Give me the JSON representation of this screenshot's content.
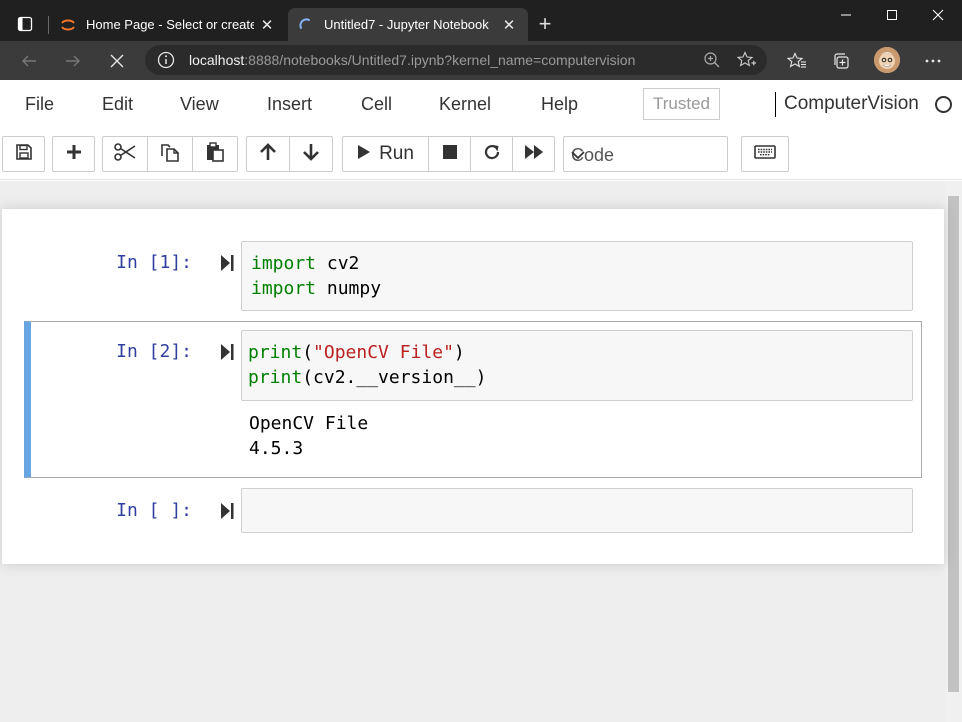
{
  "browser": {
    "tabs": [
      {
        "title": "Home Page - Select or create a n",
        "icon": "jupyter-logo-icon",
        "active": false
      },
      {
        "title": "Untitled7 - Jupyter Notebook",
        "icon": "loading-spinner-icon",
        "active": true
      }
    ],
    "url_host": "localhost",
    "url_rest": ":8888/notebooks/Untitled7.ipynb?kernel_name=computervision"
  },
  "menu": {
    "items": [
      "File",
      "Edit",
      "View",
      "Insert",
      "Cell",
      "Kernel",
      "Help"
    ],
    "trusted": "Trusted",
    "kernel_name": "ComputerVision"
  },
  "toolbar": {
    "run_label": "Run",
    "cell_type": "Code"
  },
  "cells": [
    {
      "prompt": "In [1]:",
      "code": [
        "import cv2",
        "import numpy"
      ],
      "output": []
    },
    {
      "prompt": "In [2]:",
      "code": [
        "print(\"OpenCV File\")",
        "print(cv2.__version__)"
      ],
      "output": [
        "OpenCV File",
        "4.5.3"
      ]
    },
    {
      "prompt": "In [ ]:",
      "code": [],
      "output": []
    }
  ],
  "code_tokens": {
    "import_kw": "import",
    "cv2": " cv2",
    "numpy": " numpy",
    "print_fn": "print",
    "open_paren": "(",
    "string_lit": "\"OpenCV File\"",
    "close_paren": ")",
    "version_args": "(cv2.__version__)"
  },
  "colors": {
    "accent_selected": "#66a6e3",
    "prompt": "#303f9f",
    "keyword": "#008000",
    "string": "#ba2121"
  }
}
